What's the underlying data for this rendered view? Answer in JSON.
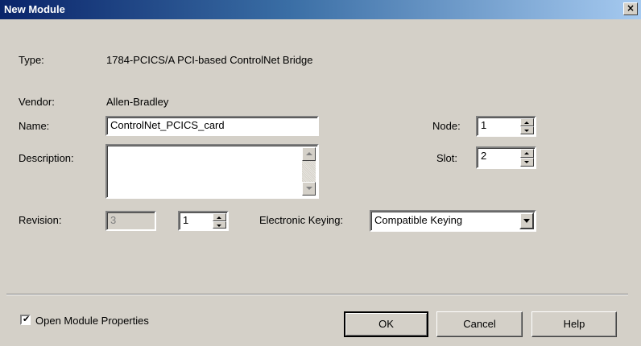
{
  "window": {
    "title": "New Module",
    "close_glyph": "×"
  },
  "type": {
    "label": "Type:",
    "value": "1784-PCICS/A PCI-based ControlNet Bridge"
  },
  "vendor": {
    "label": "Vendor:",
    "value": "Allen-Bradley"
  },
  "name": {
    "label": "Name:",
    "value": "ControlNet_PCICS_card"
  },
  "description": {
    "label": "Description:",
    "value": ""
  },
  "revision": {
    "label": "Revision:",
    "major": "3",
    "minor": "1"
  },
  "keying": {
    "label": "Electronic Keying:",
    "selected": "Compatible Keying"
  },
  "node": {
    "label": "Node:",
    "value": "1"
  },
  "slot": {
    "label": "Slot:",
    "value": "2"
  },
  "open_props": {
    "label": "Open Module Properties",
    "checked": true,
    "check_glyph": "✔"
  },
  "buttons": {
    "ok": "OK",
    "cancel": "Cancel",
    "help": "Help"
  }
}
